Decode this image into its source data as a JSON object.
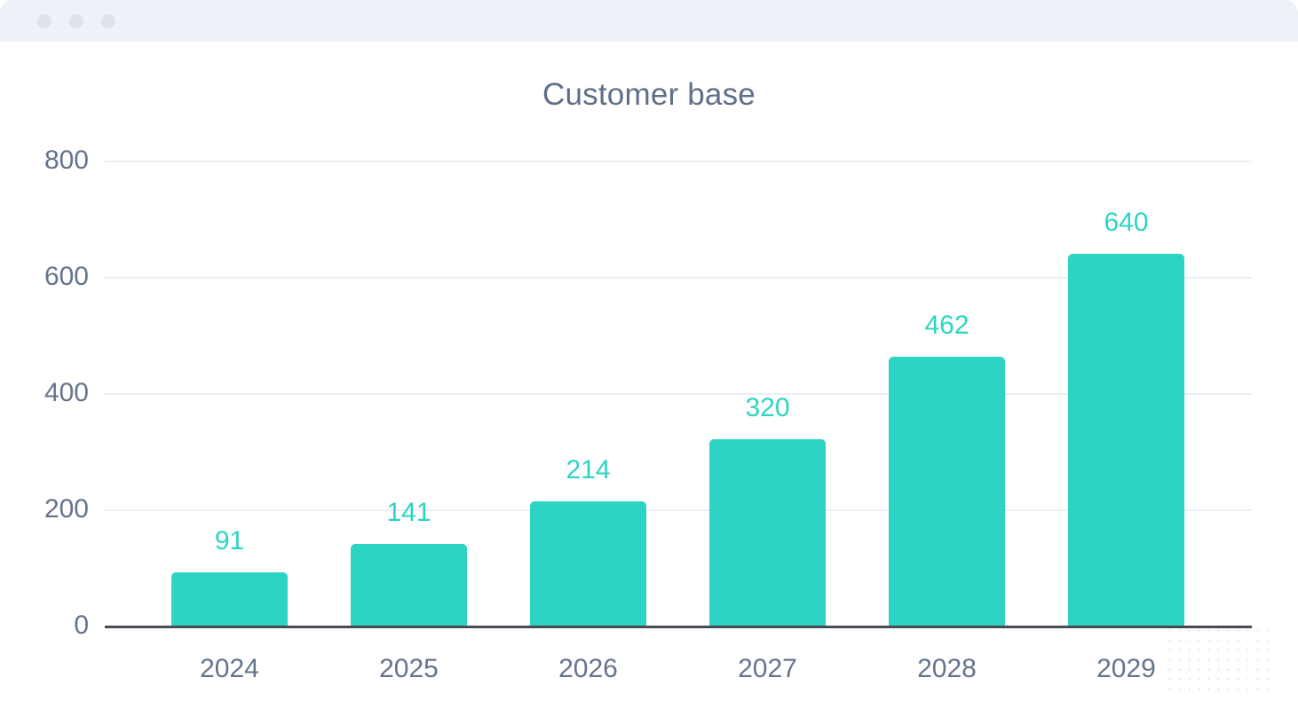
{
  "window": {
    "dots": [
      "close-dot",
      "minimize-dot",
      "maximize-dot"
    ],
    "titlebar_color": "#eef1f7"
  },
  "chart_data": {
    "type": "bar",
    "title": "Customer base",
    "xlabel": "",
    "ylabel": "",
    "categories": [
      "2024",
      "2025",
      "2026",
      "2027",
      "2028",
      "2029"
    ],
    "values": [
      91,
      141,
      214,
      320,
      462,
      640
    ],
    "value_labels": [
      "91",
      "141",
      "214",
      "320",
      "462",
      "640"
    ],
    "ylim": [
      0,
      800
    ],
    "yticks": [
      0,
      200,
      400,
      600,
      800
    ],
    "ytick_labels": [
      "0",
      "200",
      "400",
      "600",
      "800"
    ],
    "grid": true,
    "legend": false,
    "series": [
      {
        "name": "Customer base",
        "values": [
          91,
          141,
          214,
          320,
          462,
          640
        ],
        "color": "#2dd4c3"
      }
    ],
    "colors": {
      "bar": "#2dd4c3",
      "data_label": "#2dd4c3",
      "title": "#606f89",
      "tick_label": "#65748d",
      "gridline": "#eceef3",
      "axis": "#4a4a52",
      "background": "#ffffff"
    }
  }
}
